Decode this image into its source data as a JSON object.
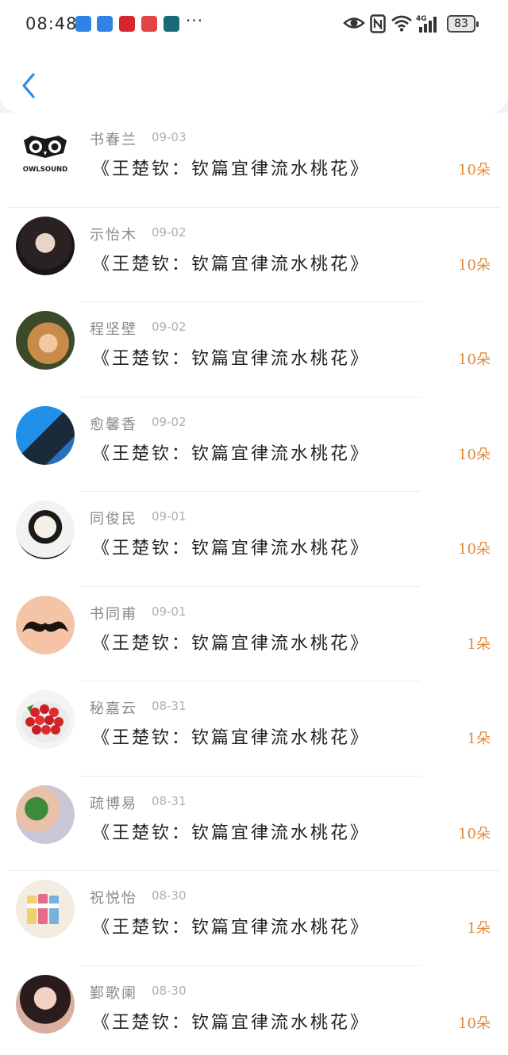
{
  "status_bar": {
    "time": "08:48",
    "battery": "83",
    "notification_icons": [
      "puzzle-icon",
      "puzzle-icon",
      "heart-app-icon",
      "mail-app-icon",
      "send-app-icon"
    ],
    "overflow": "···",
    "right_icons": [
      "eye-icon",
      "nfc-icon",
      "wifi-icon",
      "signal-4g-icon",
      "battery-icon"
    ]
  },
  "header": {
    "back_icon": "chevron-left-icon"
  },
  "items": [
    {
      "name": "书春兰",
      "date": "09-03",
      "title": "《王楚钦：钦篇宜律流水桃花》",
      "count": "10朵",
      "avatar": "owlsound-logo"
    },
    {
      "name": "示怡木",
      "date": "09-02",
      "title": "《王楚钦：钦篇宜律流水桃花》",
      "count": "10朵",
      "avatar": "girl-photo"
    },
    {
      "name": "程坚壁",
      "date": "09-02",
      "title": "《王楚钦：钦篇宜律流水桃花》",
      "count": "10朵",
      "avatar": "girl-photo"
    },
    {
      "name": "愈馨香",
      "date": "09-02",
      "title": "《王楚钦：钦篇宜律流水桃花》",
      "count": "10朵",
      "avatar": "blue-helmet"
    },
    {
      "name": "同俊民",
      "date": "09-01",
      "title": "《王楚钦：钦篇宜律流水桃花》",
      "count": "10朵",
      "avatar": "cartoon-boy"
    },
    {
      "name": "书同甫",
      "date": "09-01",
      "title": "《王楚钦：钦篇宜律流水桃花》",
      "count": "1朵",
      "avatar": "mustache"
    },
    {
      "name": "秘嘉云",
      "date": "08-31",
      "title": "《王楚钦：钦篇宜律流水桃花》",
      "count": "1朵",
      "avatar": "cherries"
    },
    {
      "name": "疏博易",
      "date": "08-31",
      "title": "《王楚钦：钦篇宜律流水桃花》",
      "count": "10朵",
      "avatar": "baby-photo"
    },
    {
      "name": "祝悦怡",
      "date": "08-30",
      "title": "《王楚钦：钦篇宜律流水桃花》",
      "count": "1朵",
      "avatar": "stationery"
    },
    {
      "name": "鄞歌阑",
      "date": "08-30",
      "title": "《王楚钦：钦篇宜律流水桃花》",
      "count": "10朵",
      "avatar": "girl-photo"
    }
  ]
}
